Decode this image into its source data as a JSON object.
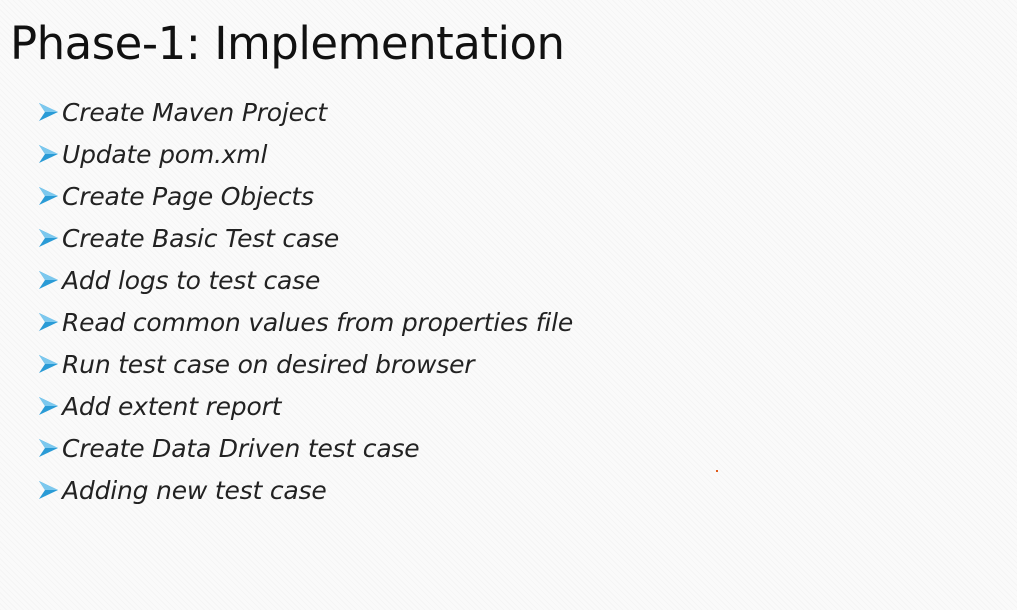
{
  "slide": {
    "title": "Phase-1: Implementation",
    "bullet_icon": "arrowhead-bullet-icon",
    "bullet_color": "#2a9bd6",
    "items": [
      {
        "label": "Create Maven Project"
      },
      {
        "label": "Update pom.xml"
      },
      {
        "label": "Create Page Objects"
      },
      {
        "label": "Create Basic Test case"
      },
      {
        "label": "Add logs to test case"
      },
      {
        "label": "Read common values from properties file"
      },
      {
        "label": "Run test case on desired browser"
      },
      {
        "label": "Add extent report"
      },
      {
        "label": "Create Data Driven test case"
      },
      {
        "label": "Adding new test case"
      }
    ]
  }
}
